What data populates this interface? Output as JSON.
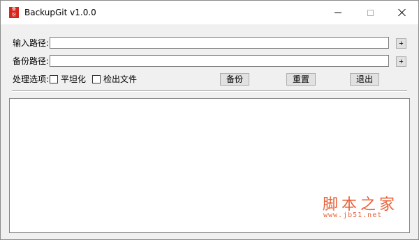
{
  "window": {
    "title": "BackupGit v1.0.0",
    "icon_text": [
      "备",
      "份"
    ]
  },
  "form": {
    "input_path_label": "输入路径:",
    "input_path_value": "",
    "backup_path_label": "备份路径:",
    "backup_path_value": "",
    "browse_label": "+",
    "options_label": "处理选项:",
    "flatten_label": "平坦化",
    "flatten_checked": false,
    "checkout_label": "检出文件",
    "checkout_checked": false
  },
  "buttons": {
    "backup": "备份",
    "reset": "重置",
    "exit": "退出"
  },
  "log": {
    "content": ""
  },
  "watermark": {
    "chinese": "脚本之家",
    "url": "www.jb51.net"
  },
  "colors": {
    "watermark": "#e8623a",
    "icon": "#d8261c"
  }
}
